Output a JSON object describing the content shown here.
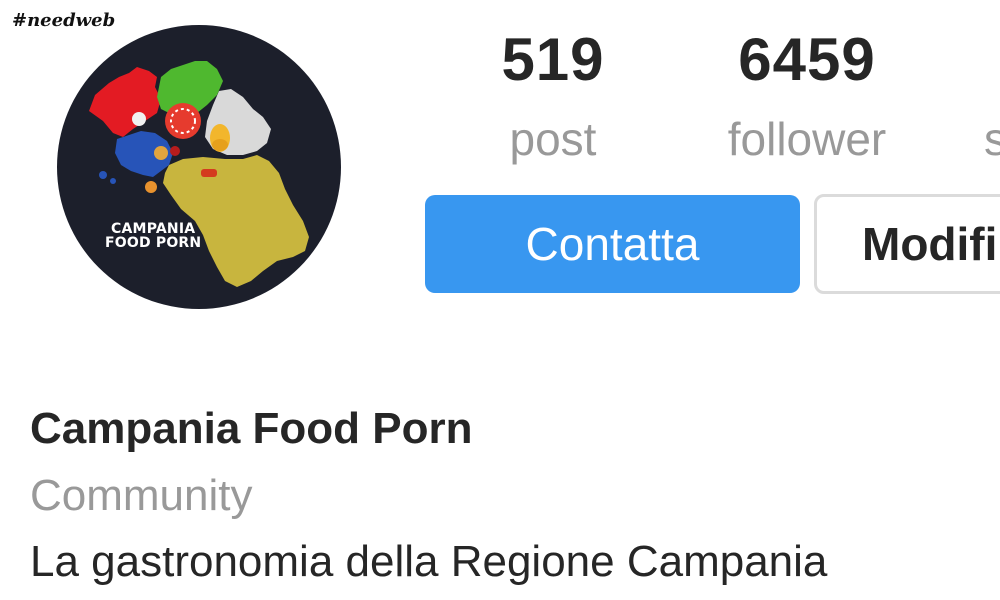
{
  "watermark": "#needweb",
  "profile": {
    "avatar_logo_line1": "CAMPANIA",
    "avatar_logo_line2": "FOOD PORN",
    "name": "Campania Food Porn",
    "category": "Community",
    "bio": "La gastronomia della Regione Campania"
  },
  "stats": [
    {
      "value": "519",
      "label": "post"
    },
    {
      "value": "6459",
      "label": "follower"
    },
    {
      "value": "",
      "label": "s"
    }
  ],
  "buttons": {
    "contact_label": "Contatta",
    "edit_label": "Modifi"
  },
  "colors": {
    "primary_button": "#3897f0",
    "secondary_text": "#999999",
    "primary_text": "#262626",
    "avatar_background": "#1c1f2b"
  }
}
